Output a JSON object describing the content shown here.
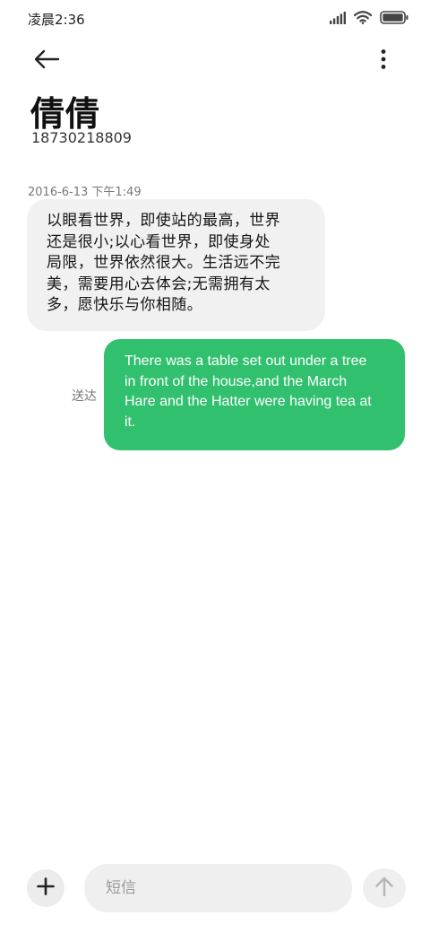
{
  "status_bar": {
    "time": "凌晨2:36",
    "icons": [
      "signal-icon",
      "wifi-icon",
      "battery-icon"
    ]
  },
  "toolbar": {
    "back_icon": "arrow-left-icon",
    "more_icon": "more-vertical-icon"
  },
  "contact": {
    "name": "倩倩",
    "number": "18730218809"
  },
  "conversation": {
    "timestamp": "2016-6-13 下午1:49",
    "messages": [
      {
        "direction": "incoming",
        "lines": [
          "以眼看世界，即使站的最高，世界",
          "还是很小;以心看世界，即使身处",
          "局限，世界依然很大。生活远不完",
          "美，需要用心去体会;无需拥有太",
          "多，愿快乐与你相随。"
        ]
      },
      {
        "direction": "outgoing",
        "status": "送达",
        "lines": [
          "There was a table set out under a tree",
          "in front of the house,and the March",
          "Hare and the Hatter were having tea at",
          "it."
        ]
      }
    ]
  },
  "composer": {
    "add_icon": "plus-icon",
    "placeholder": "短信",
    "send_icon": "arrow-up-icon"
  },
  "colors": {
    "outgoing_bubble": "#31c06e",
    "incoming_bubble": "#f1f1f1",
    "background": "#ffffff"
  }
}
